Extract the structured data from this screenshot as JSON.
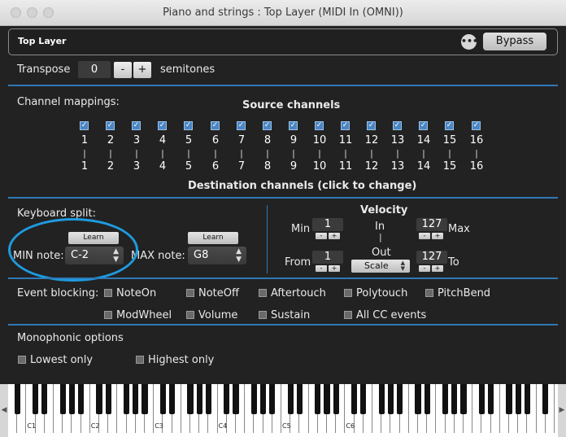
{
  "window": {
    "title": "Piano and strings : Top Layer (MIDI In (OMNI))"
  },
  "header": {
    "layer_name": "Top Layer",
    "more_label": "•••",
    "bypass_label": "Bypass"
  },
  "transpose": {
    "label": "Transpose",
    "value": "0",
    "minus": "-",
    "plus": "+",
    "unit": "semitones"
  },
  "channels": {
    "label": "Channel mappings:",
    "source_title": "Source channels",
    "dest_title": "Destination channels (click to change)",
    "source": [
      "1",
      "2",
      "3",
      "4",
      "5",
      "6",
      "7",
      "8",
      "9",
      "10",
      "11",
      "12",
      "13",
      "14",
      "15",
      "16"
    ],
    "dest": [
      "1",
      "2",
      "3",
      "4",
      "5",
      "6",
      "7",
      "8",
      "9",
      "10",
      "11",
      "12",
      "13",
      "14",
      "15",
      "16"
    ],
    "checked": [
      true,
      true,
      true,
      true,
      true,
      true,
      true,
      true,
      true,
      true,
      true,
      true,
      true,
      true,
      true,
      true
    ],
    "divider": "|"
  },
  "split": {
    "label": "Keyboard split:",
    "learn_label": "Learn",
    "min_label": "MIN note:",
    "min_value": "C-2",
    "max_label": "MAX note:",
    "max_value": "G8"
  },
  "velocity": {
    "title": "Velocity",
    "in_label": "In",
    "out_label": "Out",
    "min_label": "Min",
    "max_label": "Max",
    "from_label": "From",
    "to_label": "To",
    "min_value": "1",
    "max_value": "127",
    "from_value": "1",
    "to_value": "127",
    "mode_value": "Scale",
    "minus": "-",
    "plus": "+",
    "divider": "|"
  },
  "blocking": {
    "label": "Event blocking:",
    "items": [
      "NoteOn",
      "NoteOff",
      "Aftertouch",
      "Polytouch",
      "PitchBend",
      "ModWheel",
      "Volume",
      "Sustain",
      "All CC events"
    ]
  },
  "mono": {
    "label": "Monophonic options",
    "items": [
      "Lowest only",
      "Highest only"
    ]
  },
  "keyboard": {
    "octaves": [
      "C1",
      "C2",
      "C3",
      "C4",
      "C5",
      "C6"
    ],
    "left_arrow": "◀",
    "right_arrow": "▶"
  },
  "colors": {
    "accent": "#2f79b6",
    "highlight": "#1e9be0"
  }
}
